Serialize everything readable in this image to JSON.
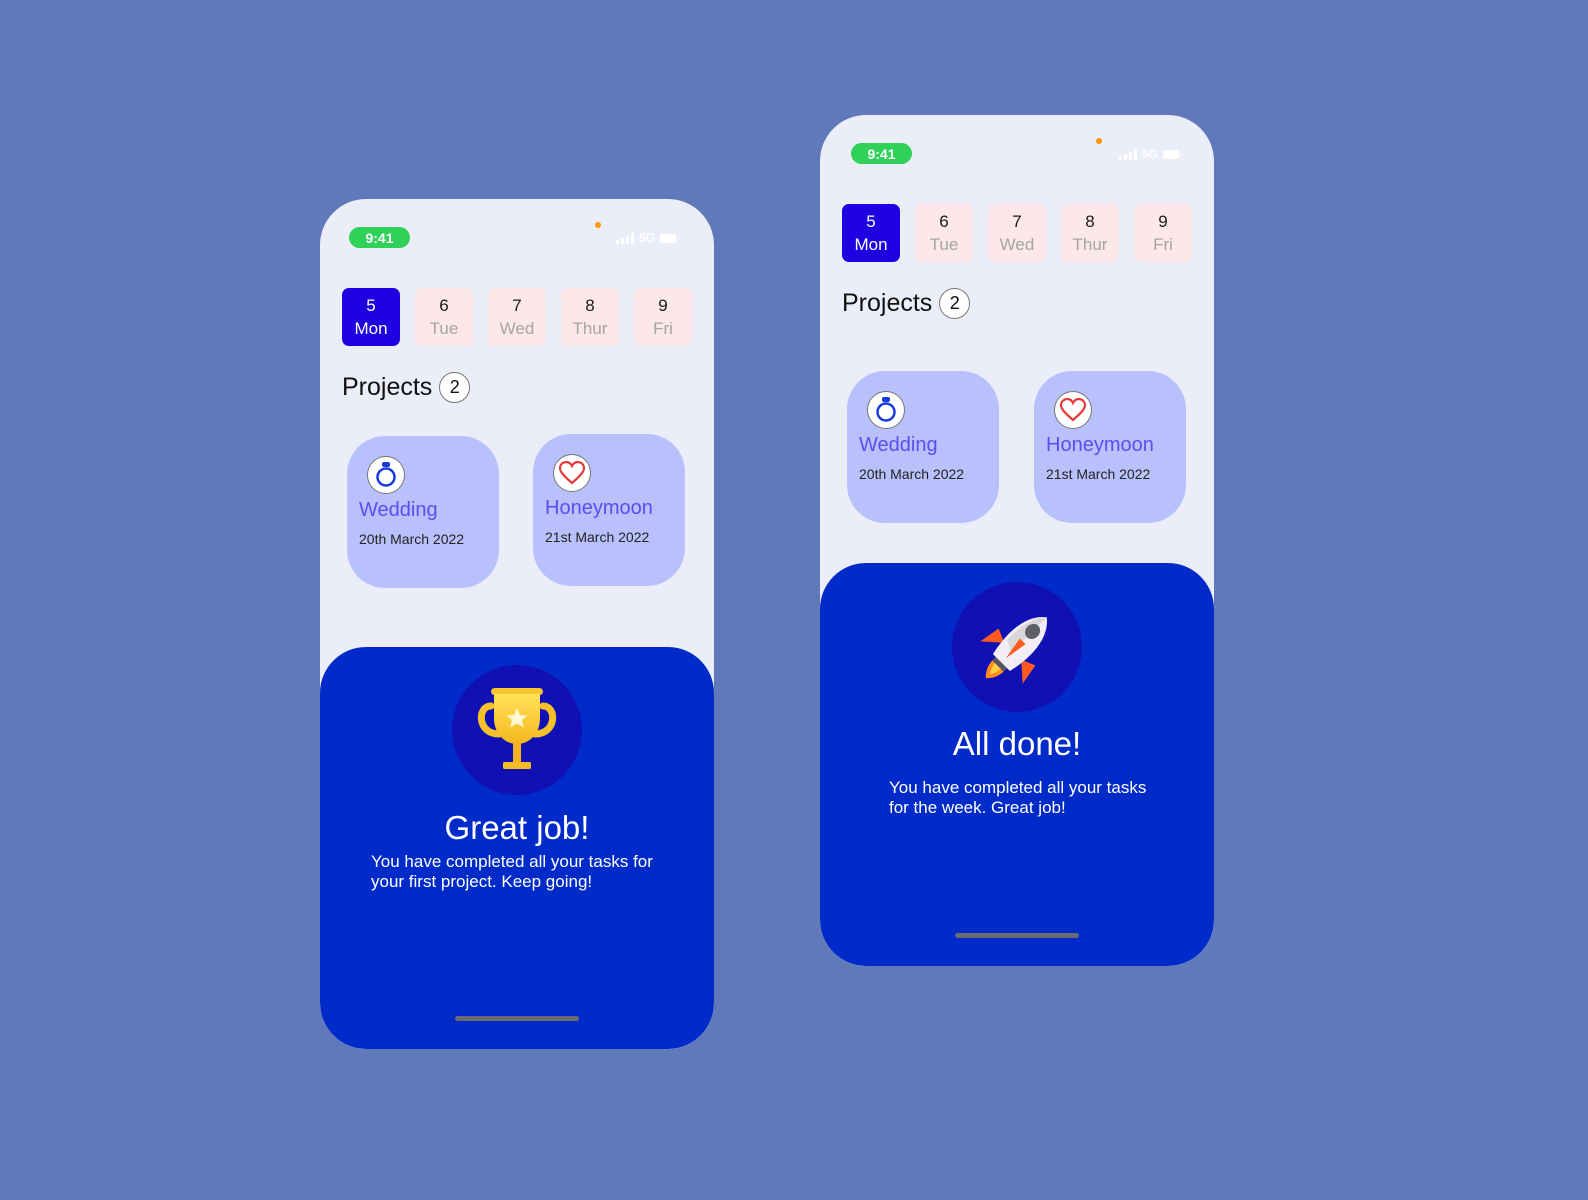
{
  "colors": {
    "background": "#6079bb",
    "phone_bg": "#ebeef8",
    "active_day": "#1f00e0",
    "inactive_day": "#fce7e9",
    "card": "#b9c1fc",
    "card_title": "#5a4ef0",
    "sheet": "#002bc8",
    "time_pill": "#30d158"
  },
  "screens": [
    {
      "status_bar": {
        "time": "9:41",
        "network": "5G"
      },
      "days": [
        {
          "num": "5",
          "name": "Mon",
          "active": true
        },
        {
          "num": "6",
          "name": "Tue",
          "active": false
        },
        {
          "num": "7",
          "name": "Wed",
          "active": false
        },
        {
          "num": "8",
          "name": "Thur",
          "active": false
        },
        {
          "num": "9",
          "name": "Fri",
          "active": false
        }
      ],
      "projects": {
        "title": "Projects",
        "count": "2",
        "items": [
          {
            "icon": "ring-icon",
            "title": "Wedding",
            "date": "20th March 2022"
          },
          {
            "icon": "heart-icon",
            "title": "Honeymoon",
            "date": "21st March 2022"
          }
        ]
      },
      "sheet": {
        "icon": "trophy-icon",
        "title": "Great job!",
        "text": "You have completed all your tasks for your first project. Keep going!"
      }
    },
    {
      "status_bar": {
        "time": "9:41",
        "network": "5G"
      },
      "days": [
        {
          "num": "5",
          "name": "Mon",
          "active": true
        },
        {
          "num": "6",
          "name": "Tue",
          "active": false
        },
        {
          "num": "7",
          "name": "Wed",
          "active": false
        },
        {
          "num": "8",
          "name": "Thur",
          "active": false
        },
        {
          "num": "9",
          "name": "Fri",
          "active": false
        }
      ],
      "projects": {
        "title": "Projects",
        "count": "2",
        "items": [
          {
            "icon": "ring-icon",
            "title": "Wedding",
            "date": "20th March 2022"
          },
          {
            "icon": "heart-icon",
            "title": "Honeymoon",
            "date": "21st March 2022"
          }
        ]
      },
      "sheet": {
        "icon": "rocket-icon",
        "title": "All done!",
        "text": "You have completed all your tasks for the week. Great job!"
      }
    }
  ]
}
